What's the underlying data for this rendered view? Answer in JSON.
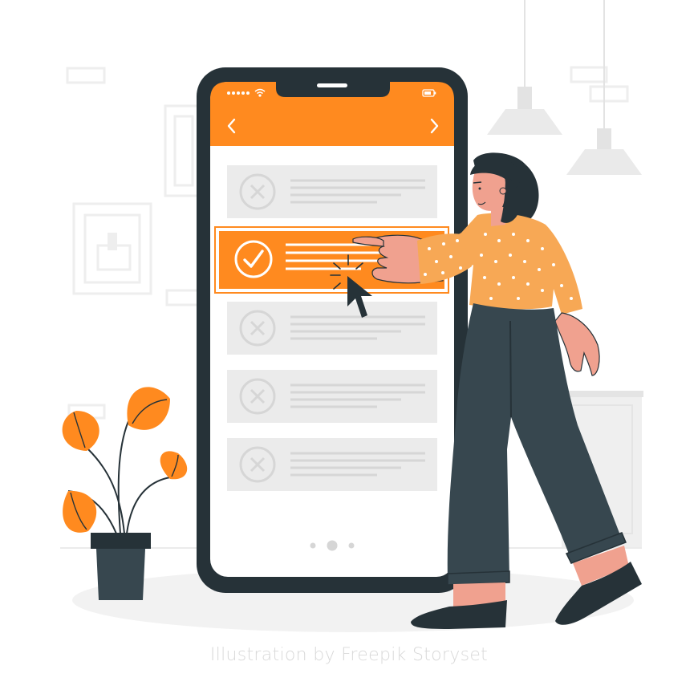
{
  "credit": "Illustration by Freepik Storyset",
  "colors": {
    "accent": "#FF8A1F",
    "phone_frame": "#263238",
    "card_bg": "#EBEBEB",
    "card_line": "#D6D6D6",
    "wall_item": "#EEEEEE",
    "pants": "#37474F",
    "shirt": "#F7A855",
    "skin": "#F0A18F",
    "hair": "#263238",
    "credit_text": "#D9D9D9"
  },
  "phone": {
    "status_icons": [
      "signal-dots-icon",
      "wifi-icon",
      "battery-icon"
    ],
    "nav_icons": [
      "chevron-left-icon",
      "chevron-right-icon"
    ],
    "list_items": [
      {
        "state": "rejected",
        "icon": "x-circle-icon"
      },
      {
        "state": "selected",
        "icon": "check-circle-icon"
      },
      {
        "state": "rejected",
        "icon": "x-circle-icon"
      },
      {
        "state": "rejected",
        "icon": "x-circle-icon"
      },
      {
        "state": "rejected",
        "icon": "x-circle-icon"
      }
    ],
    "page_dots": 3,
    "active_page_dot": 2
  }
}
